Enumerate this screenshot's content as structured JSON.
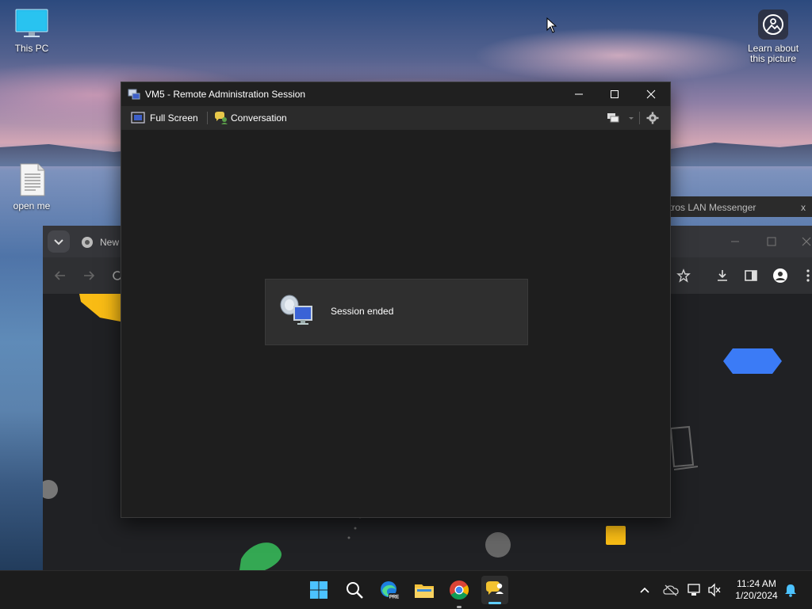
{
  "desktop": {
    "icons": [
      {
        "label": "This PC"
      },
      {
        "label": "open me"
      }
    ],
    "learn": {
      "label_line1": "Learn about",
      "label_line2": "this picture"
    }
  },
  "chrome": {
    "tab_label": "New"
  },
  "lan_messenger": {
    "title": "tros LAN Messenger",
    "close": "x"
  },
  "remote_window": {
    "title": "VM5 - Remote Administration Session",
    "toolbar": {
      "full_screen": "Full Screen",
      "conversation": "Conversation"
    },
    "session_message": "Session ended"
  },
  "taskbar": {
    "clock_time": "11:24 AM",
    "clock_date": "1/20/2024",
    "edge_badge": "PRE"
  },
  "colors": {
    "taskbar_bg": "#1c1c1c",
    "window_bg": "#1e1e1e",
    "accent": "#60cdff"
  }
}
